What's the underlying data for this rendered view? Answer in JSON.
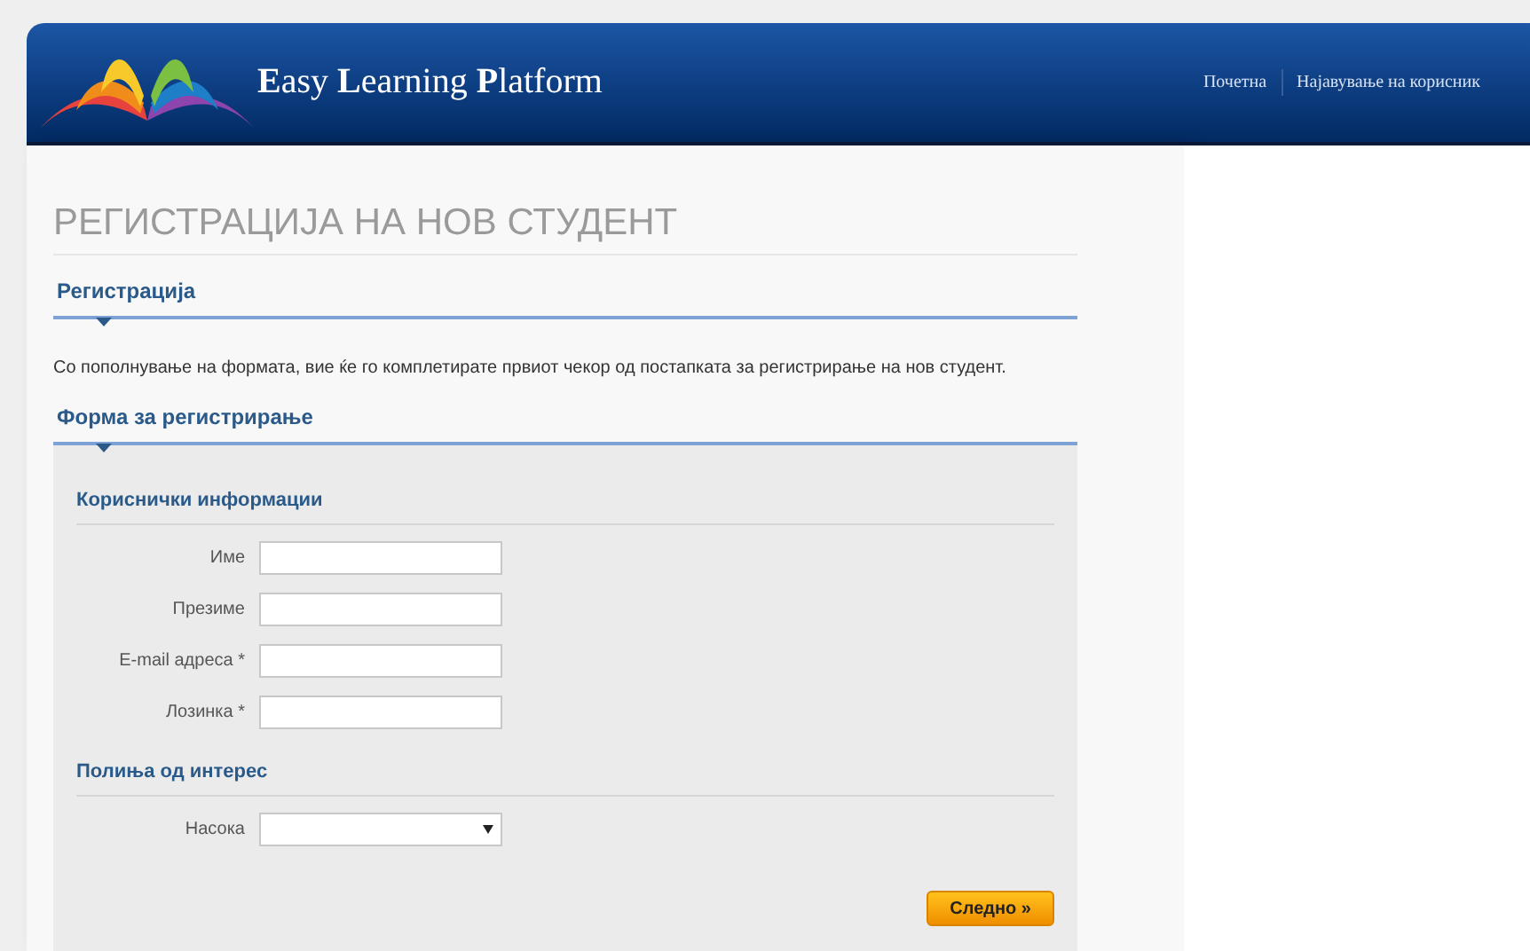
{
  "header": {
    "brand": "**E**asy **L**earning **P**latform",
    "nav": [
      "Почетна",
      "Најавување на корисник"
    ]
  },
  "page_title": "РЕГИСТРАЦИЈА НА НОВ СТУДЕНТ",
  "intro": {
    "heading": "Регистрација",
    "text": "Со пополнување на формата, вие ќе го комплетирате првиот чекор од постапката за регистрирање на нов студент."
  },
  "form": {
    "heading": "Форма за регистрирање",
    "sections": [
      {
        "title": "Кориснички информации",
        "fields": [
          {
            "label": "Име",
            "kind": "text"
          },
          {
            "label": "Презиме",
            "kind": "text"
          },
          {
            "label": "E-mail адреса *",
            "kind": "text"
          },
          {
            "label": "Лозинка *",
            "kind": "password"
          }
        ]
      },
      {
        "title": "Полиња од интерес",
        "fields": [
          {
            "label": "Насока",
            "kind": "select"
          }
        ]
      }
    ],
    "submit": "Следно »"
  }
}
